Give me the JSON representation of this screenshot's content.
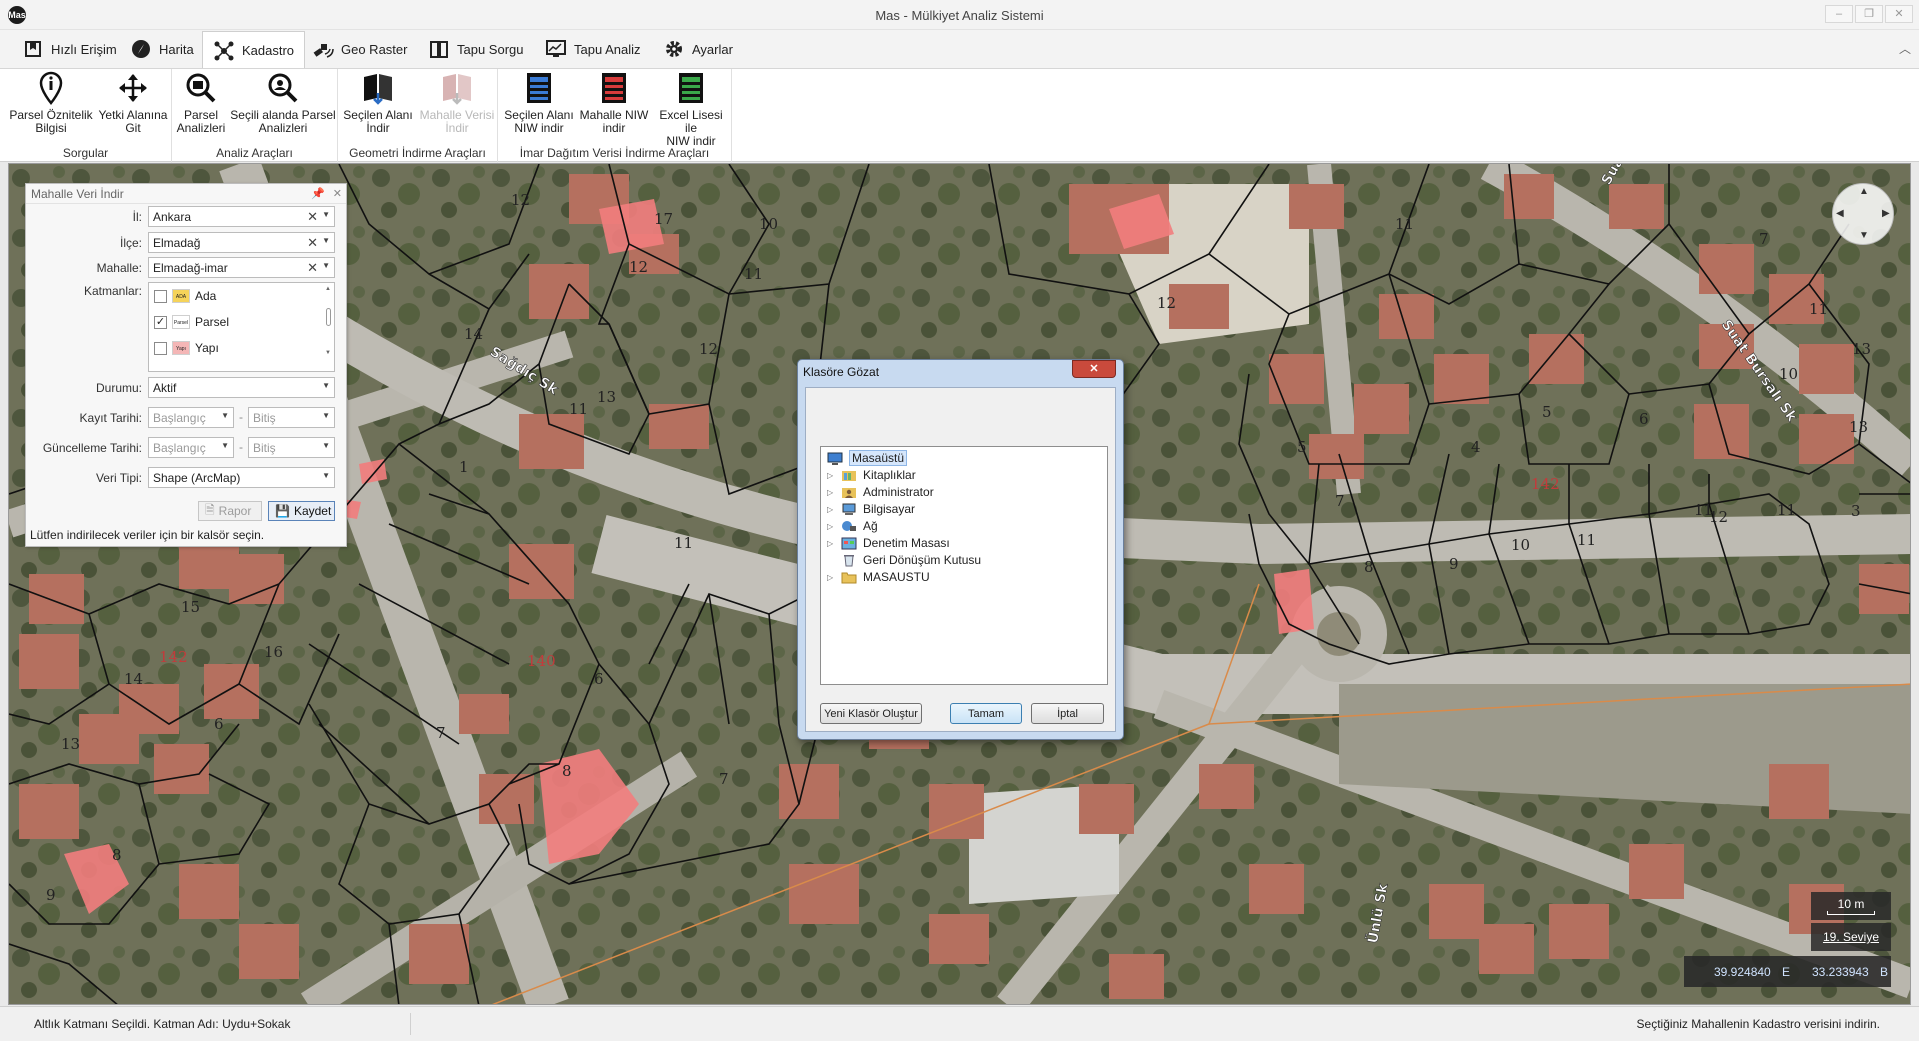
{
  "window": {
    "title": "Mas - Mülkiyet Analiz Sistemi",
    "logo_text": "Mas",
    "controls": {
      "minimize": "–",
      "restore": "❐",
      "close": "✕"
    }
  },
  "tabs": [
    {
      "label": "Hızlı Erişim",
      "icon": "bookmark-icon"
    },
    {
      "label": "Harita",
      "icon": "compass-icon"
    },
    {
      "label": "Kadastro",
      "icon": "network-icon",
      "active": true
    },
    {
      "label": "Geo Raster",
      "icon": "satellite-icon"
    },
    {
      "label": "Tapu Sorgu",
      "icon": "book-icon"
    },
    {
      "label": "Tapu Analiz",
      "icon": "monitor-chart-icon"
    },
    {
      "label": "Ayarlar",
      "icon": "gear-icon"
    }
  ],
  "ribbon": {
    "groups": [
      {
        "title": "Sorgular",
        "buttons": [
          {
            "label1": "Parsel Öznitelik",
            "label2": "Bilgisi",
            "icon": "info-pin-icon"
          },
          {
            "label1": "Yetki Alanına",
            "label2": "Git",
            "icon": "move-arrows-icon"
          }
        ]
      },
      {
        "title": "Analiz Araçları",
        "buttons": [
          {
            "label1": "Parsel",
            "label2": "Analizleri",
            "icon": "magnifier-parcel-icon"
          },
          {
            "label1": "Seçili alanda Parsel",
            "label2": "Analizleri",
            "icon": "magnifier-area-icon"
          }
        ]
      },
      {
        "title": "Geometri İndirme Araçları",
        "buttons": [
          {
            "label1": "Seçilen Alanı",
            "label2": "İndir",
            "icon": "map-book-icon"
          },
          {
            "label1": "Mahalle Verisi",
            "label2": "İndir",
            "icon": "map-book-disabled-icon",
            "disabled": true
          }
        ]
      },
      {
        "title": "İmar Dağıtım Verisi İndirme Araçları",
        "buttons": [
          {
            "label1": "Seçilen Alanı",
            "label2": "NIW indir",
            "icon": "niw-blue-icon"
          },
          {
            "label1": "Mahalle NIW",
            "label2": "indir",
            "icon": "niw-red-icon"
          },
          {
            "label1": "Excel Lisesi ile",
            "label2": "NIW indir",
            "icon": "niw-green-icon"
          }
        ]
      }
    ]
  },
  "panel": {
    "title": "Mahalle Veri İndir",
    "il_label": "İl:",
    "il_value": "Ankara",
    "ilce_label": "İlçe:",
    "ilce_value": "Elmadağ",
    "mahalle_label": "Mahalle:",
    "mahalle_value": "Elmadağ-imar",
    "katmanlar_label": "Katmanlar:",
    "layers": [
      {
        "name": "Ada",
        "icon_text": "ADA",
        "checked": false
      },
      {
        "name": "Parsel",
        "icon_text": "Parsel",
        "checked": true
      },
      {
        "name": "Yapı",
        "icon_text": "Yapı",
        "checked": false
      }
    ],
    "durumu_label": "Durumu:",
    "durumu_value": "Aktif",
    "kayit_label": "Kayıt Tarihi:",
    "guncelleme_label": "Güncelleme Tarihi:",
    "start_placeholder": "Başlangıç",
    "end_placeholder": "Bitiş",
    "range_sep": "-",
    "veri_tipi_label": "Veri Tipi:",
    "veri_tipi_value": "Shape (ArcMap)",
    "rapor_label": "Rapor",
    "kaydet_label": "Kaydet",
    "status": "Lütfen indirilecek veriler için bir kalsör seçin."
  },
  "dialog": {
    "title": "Klasöre Gözat",
    "close": "✕",
    "tree": [
      {
        "label": "Masaüstü",
        "icon": "desktop-icon",
        "level": 0,
        "selected": true
      },
      {
        "label": "Kitaplıklar",
        "icon": "libraries-icon",
        "level": 1
      },
      {
        "label": "Administrator",
        "icon": "user-folder-icon",
        "level": 1
      },
      {
        "label": "Bilgisayar",
        "icon": "computer-icon",
        "level": 1
      },
      {
        "label": "Ağ",
        "icon": "network-icon",
        "level": 1
      },
      {
        "label": "Denetim Masası",
        "icon": "control-panel-icon",
        "level": 1
      },
      {
        "label": "Geri Dönüşüm Kutusu",
        "icon": "recycle-bin-icon",
        "level": 1,
        "leaf": true
      },
      {
        "label": "MASAUSTU",
        "icon": "folder-icon",
        "level": 1
      }
    ],
    "new_folder": "Yeni Klasör Oluştur",
    "ok": "Tamam",
    "cancel": "İptal"
  },
  "map": {
    "street_labels": [
      "Sağdıç Sk",
      "Suat Bursalı Sk",
      "Suat Bursalı Sk",
      "Ünlü Sk"
    ],
    "parcel_numbers": [
      "17",
      "10",
      "11",
      "12",
      "12",
      "14",
      "14",
      "11",
      "12",
      "13",
      "1",
      "11",
      "15",
      "16",
      "14",
      "6",
      "13",
      "8",
      "9",
      "7",
      "6",
      "7",
      "8",
      "12",
      "11",
      "5",
      "4",
      "5",
      "7",
      "8",
      "9",
      "10",
      "11",
      "12",
      "6",
      "7",
      "11",
      "10",
      "13",
      "11",
      "3",
      "11",
      "13"
    ],
    "block_labels": [
      "142",
      "142",
      "140"
    ],
    "scale": "10 m",
    "level": "19. Seviye",
    "lat": "39.924840",
    "lat_dir": "E",
    "lon": "33.233943",
    "lon_dir": "B"
  },
  "statusbar": {
    "left": "Altlık Katmanı Seçildi. Katman Adı: Uydu+Sokak",
    "right": "Seçtiğiniz Mahallenin Kadastro verisini indirin."
  },
  "colors": {
    "accent": "#3c7fb1",
    "roof": "#b86a5a",
    "highlight_parcel": "#f07878",
    "parcel_line": "#111111",
    "dialog_frame": "#c8daf0",
    "close_red": "#c94a3c"
  }
}
